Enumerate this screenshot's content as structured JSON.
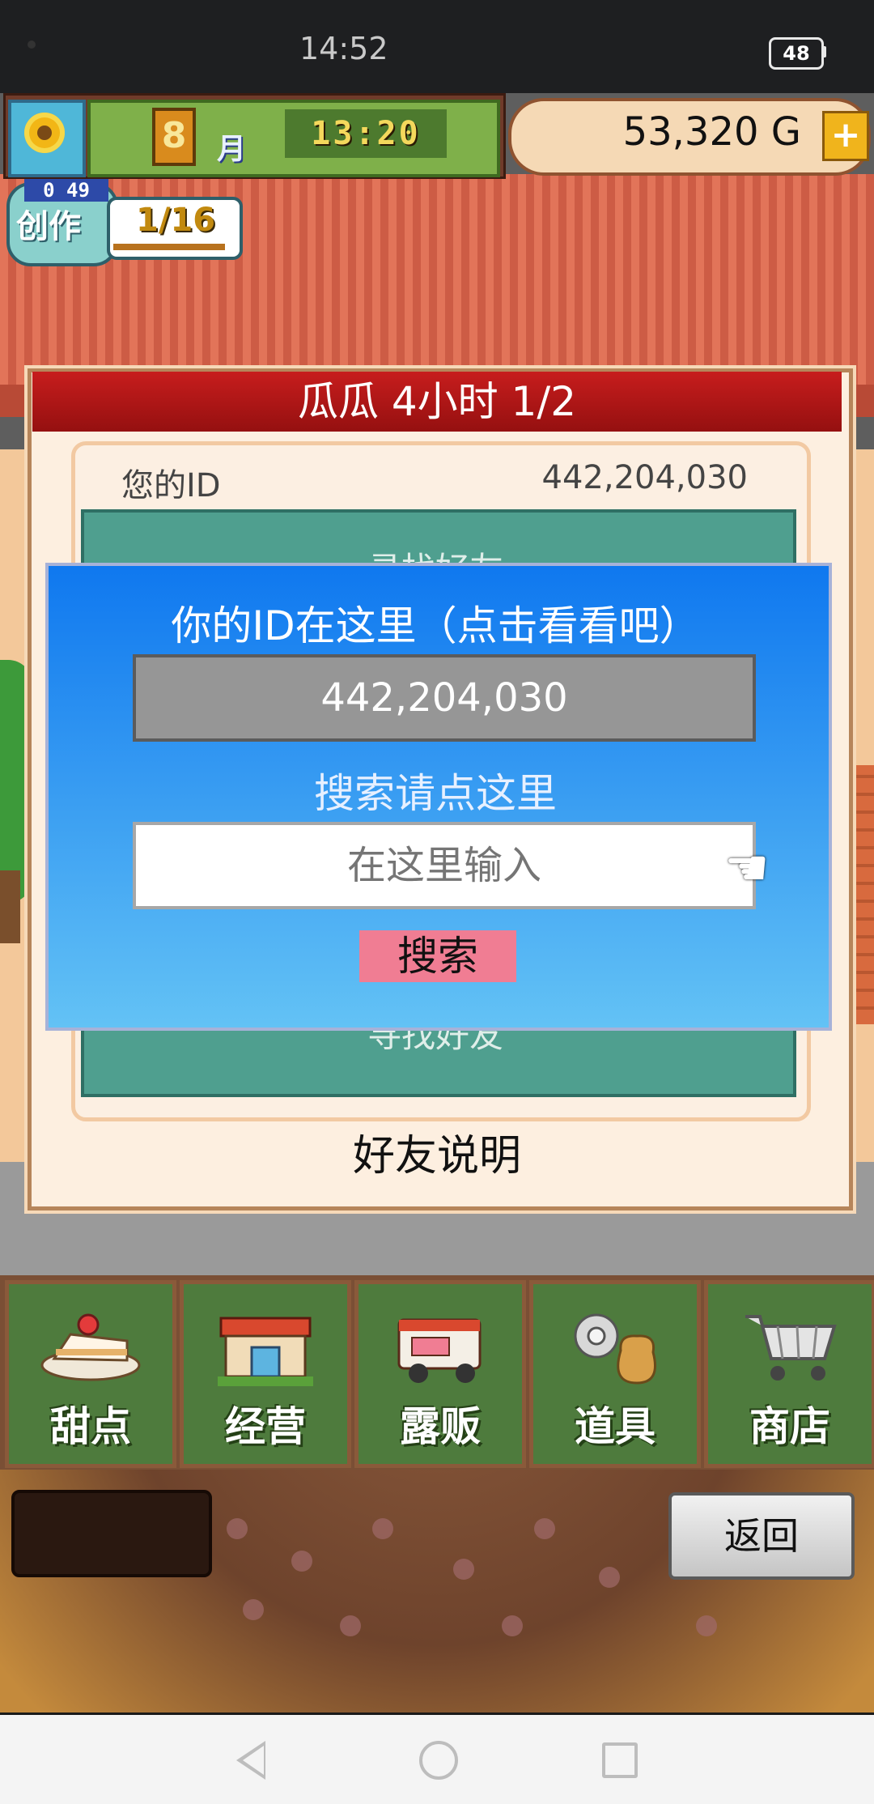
{
  "status_bar": {
    "time": "14:52",
    "battery": "48"
  },
  "hud": {
    "month_num": "8",
    "month_label": "月",
    "clock": "13:20",
    "gold": "53,320 G",
    "plus": "+"
  },
  "create": {
    "label": "创作",
    "counter": "0 49",
    "progress": "1/16"
  },
  "panel": {
    "title": "瓜瓜  4小时 1/2",
    "id_label": "您的ID",
    "id_value": "442,204,030",
    "find_friends_top": "寻找好友",
    "find_friends_bottom": "寻找好友",
    "help": "好友说明"
  },
  "dialog": {
    "title": "你的ID在这里（点击看看吧）",
    "id_value": "442,204,030",
    "search_hint": "搜索请点这里",
    "input_placeholder": "在这里输入",
    "search_button": "搜索"
  },
  "menu": {
    "items": [
      {
        "label": "甜点",
        "icon": "cake-icon"
      },
      {
        "label": "经营",
        "icon": "shop-building-icon"
      },
      {
        "label": "露贩",
        "icon": "food-truck-icon"
      },
      {
        "label": "道具",
        "icon": "tools-bag-icon"
      },
      {
        "label": "商店",
        "icon": "shopping-cart-icon"
      }
    ]
  },
  "back_button": "返回"
}
